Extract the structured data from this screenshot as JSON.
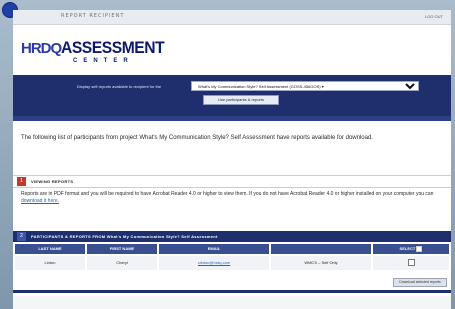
{
  "window": {
    "title": "REPORT RECIPIENT",
    "top_right_link": "LOG OUT"
  },
  "brand": {
    "logo_prefix": "HRDQ",
    "logo_main": "ASSESSMENT",
    "logo_sub": "CENTER"
  },
  "colors": {
    "brand_navy": "#1f2f6e",
    "accent_red": "#c0392b",
    "link_blue": "#1f66c2"
  },
  "report_selector": {
    "label": "Display self reports available to recipient for the",
    "selected_option": "What's My Communication Style? Self Assessment (GOSS-456GOS) ▾",
    "button_label": "Use participants & reports"
  },
  "intro_text": "The following list of participants from project What's My Communication Style? Self Assessment have reports available for download.",
  "viewing_reports": {
    "number": "1",
    "title": "VIEWING REPORTS",
    "text_before_link": "Reports are in PDF format and you will be required to have Acrobat Reader 4.0 or higher to view them. If you do not have Acrobat Reader 4.0 or higher installed on your computer you can ",
    "link_text": "download it here."
  },
  "participants": {
    "number": "2",
    "title": "PARTICIPANTS & REPORTS FROM What's My Communication Style? Self Assessment",
    "columns": [
      "LAST NAME",
      "FIRST NAME",
      "EMAIL",
      "",
      "SELECT"
    ],
    "rows": [
      {
        "last_name": "Linton",
        "first_name": "Cheryl",
        "email": "clinton@hrdq.com",
        "report": "WMCS – Self Only",
        "selected": false
      }
    ],
    "download_label": "Download selected reports"
  }
}
